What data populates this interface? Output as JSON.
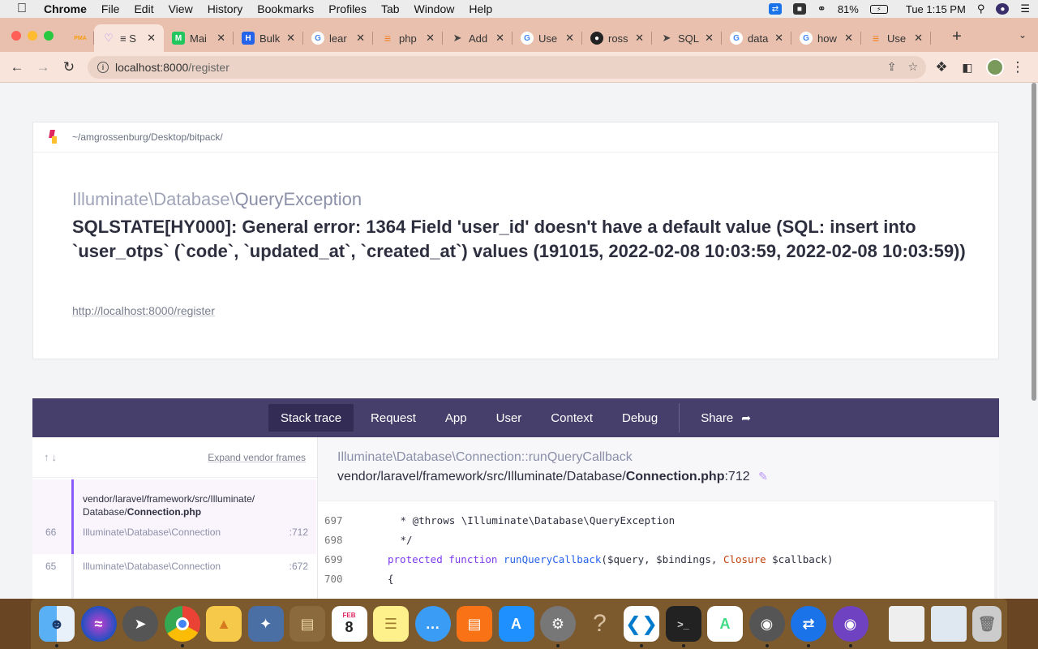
{
  "menubar": {
    "app": "Chrome",
    "items": [
      "File",
      "Edit",
      "View",
      "History",
      "Bookmarks",
      "Profiles",
      "Tab",
      "Window",
      "Help"
    ],
    "battery": "81%",
    "clock": "Tue 1:15 PM"
  },
  "tabs": [
    {
      "label": "PMA",
      "icon": "phpmyadmin-icon",
      "color": "#f89c0e"
    },
    {
      "label": "S",
      "icon": "laravel-icon",
      "color": "#a78bfa"
    },
    {
      "label": "Mai",
      "icon": "mailtrap-icon",
      "color": "#22c55e"
    },
    {
      "label": "Bulk",
      "icon": "h-icon",
      "color": "#2563eb"
    },
    {
      "label": "lear",
      "icon": "google-icon",
      "color": "#4285f4"
    },
    {
      "label": "php",
      "icon": "stackoverflow-icon",
      "color": "#f48024"
    },
    {
      "label": "Add",
      "icon": "send-icon",
      "color": "#444444"
    },
    {
      "label": "Use",
      "icon": "google-icon",
      "color": "#4285f4"
    },
    {
      "label": "ross",
      "icon": "github-icon",
      "color": "#222222"
    },
    {
      "label": "SQL",
      "icon": "send-icon",
      "color": "#444444"
    },
    {
      "label": "data",
      "icon": "google-icon",
      "color": "#4285f4"
    },
    {
      "label": "how",
      "icon": "google-icon",
      "color": "#4285f4"
    },
    {
      "label": "Use",
      "icon": "stackoverflow-icon",
      "color": "#f48024"
    }
  ],
  "address": {
    "host": "localhost:8000",
    "path": "/register"
  },
  "page": {
    "project_path": "~/amgrossenburg/Desktop/bitpack/",
    "exception_namespace": "Illuminate\\Database\\",
    "exception_class": "QueryException",
    "message": "SQLSTATE[HY000]: General error: 1364 Field 'user_id' doesn't have a default value (SQL: insert into `user_otps` (`code`, `updated_at`, `created_at`) values (191015, 2022-02-08 10:03:59, 2022-02-08 10:03:59))",
    "url": "http://localhost:8000/register"
  },
  "panel": {
    "tabs": [
      "Stack trace",
      "Request",
      "App",
      "User",
      "Context",
      "Debug"
    ],
    "share": "Share",
    "expand_vendor": "Expand vendor frames",
    "frames": [
      {
        "num": "66",
        "class": "Illuminate\\Database\\Connection",
        "line": ":712",
        "file_dir": "vendor/laravel/framework/src/Illuminate/\nDatabase/",
        "file_name": "Connection.php"
      },
      {
        "num": "65",
        "class": "Illuminate\\Database\\Connection",
        "line": ":672"
      }
    ],
    "code_class": "Illuminate\\Database\\Connection::runQueryCallback",
    "code_file_dir": "vendor/laravel/framework/src/Illuminate/Database/",
    "code_file_name": "Connection.php",
    "code_file_line": ":712",
    "code_lines": [
      {
        "n": "697",
        "text": " * @throws \\Illuminate\\Database\\QueryException"
      },
      {
        "n": "698",
        "text": " */"
      },
      {
        "n": "699",
        "kw": "protected function ",
        "fn": "runQueryCallback",
        "rest1": "($query, $bindings, ",
        "cl": "Closure",
        "rest2": " $callback)"
      },
      {
        "n": "700",
        "text": "{"
      }
    ]
  },
  "dock": [
    "Finder",
    "Siri",
    "Launchpad",
    "Chrome",
    "TablePlus",
    "Sequel",
    "Notefile",
    "Calendar",
    "Notes",
    "Messages",
    "Books",
    "App Store",
    "System Preferences",
    "Help",
    "VS Code",
    "Terminal",
    "Android Studio",
    "TablePlus",
    "TeamViewer",
    "GitHub Desktop"
  ],
  "dock_calendar": {
    "month": "FEB",
    "day": "8"
  }
}
